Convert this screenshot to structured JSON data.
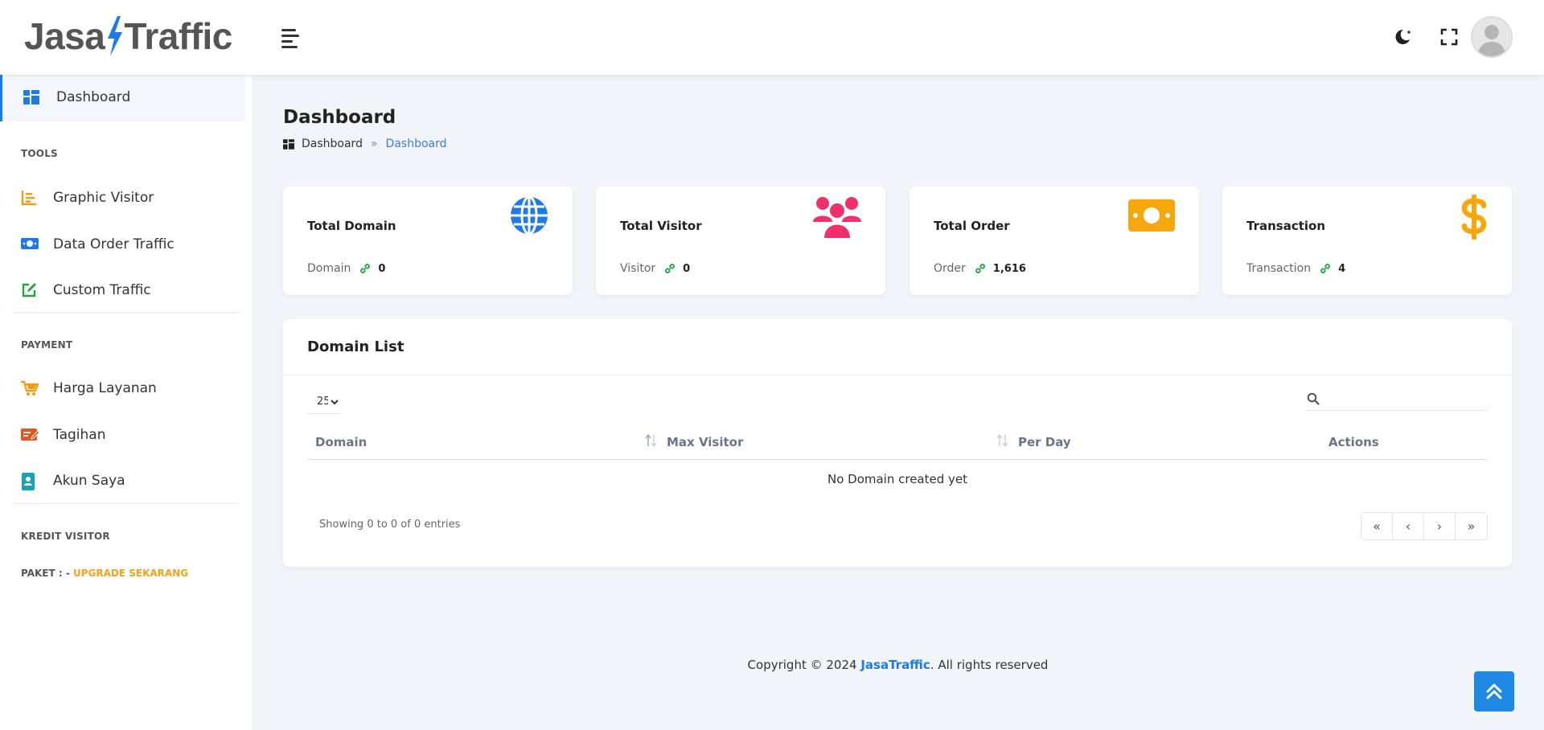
{
  "header": {
    "logo_left": "Jasa",
    "logo_right": "Traffic"
  },
  "sidebar": {
    "active": {
      "label": "Dashboard",
      "icon": "dashboard-grid-icon"
    },
    "sections": [
      {
        "title": "TOOLS",
        "items": [
          {
            "label": "Graphic Visitor",
            "icon": "bar-chart-icon",
            "color": "#f39c12"
          },
          {
            "label": "Data Order Traffic",
            "icon": "money-bill-icon",
            "color": "#1e7be6"
          },
          {
            "label": "Custom Traffic",
            "icon": "edit-icon",
            "color": "#21a544"
          }
        ]
      },
      {
        "title": "PAYMENT",
        "items": [
          {
            "label": "Harga Layanan",
            "icon": "cart-icon",
            "color": "#f39c12"
          },
          {
            "label": "Tagihan",
            "icon": "invoice-icon",
            "color": "#e8541e"
          },
          {
            "label": "Akun Saya",
            "icon": "id-card-icon",
            "color": "#17a2b8"
          }
        ]
      },
      {
        "title": "KREDIT VISITOR",
        "items": []
      }
    ],
    "paket_label": "PAKET : -",
    "paket_upgrade": "UPGRADE SEKARANG"
  },
  "main": {
    "title": "Dashboard",
    "breadcrumb": {
      "home": "Dashboard",
      "separator": "»",
      "current": "Dashboard"
    }
  },
  "cards": [
    {
      "title": "Total Domain",
      "sub_label": "Domain",
      "value": "0",
      "icon": "globe-icon",
      "color": "#1e7be6"
    },
    {
      "title": "Total Visitor",
      "sub_label": "Visitor",
      "value": "0",
      "icon": "users-icon",
      "color": "#f0306b"
    },
    {
      "title": "Total Order",
      "sub_label": "Order",
      "value": "1,616",
      "icon": "money-bill-icon",
      "color": "#f7a70c"
    },
    {
      "title": "Transaction",
      "sub_label": "Transaction",
      "value": "4",
      "icon": "dollar-icon",
      "color": "#f7a70c"
    }
  ],
  "domain_list": {
    "title": "Domain List",
    "page_length": "25",
    "search_placeholder": "",
    "columns": [
      "Domain",
      "Max Visitor",
      "Per Day",
      "Actions"
    ],
    "empty_text": "No Domain created yet",
    "info": "Showing 0 to 0 of 0 entries",
    "pager": [
      "«",
      "‹",
      "›",
      "»"
    ]
  },
  "footer": {
    "prefix": "Copyright © 2024 ",
    "brand": "JasaTraffic",
    "suffix": ". All rights reserved"
  },
  "colors": {
    "accent": "#1e7be6",
    "upgrade": "#f6a21a",
    "link_green": "#21a544"
  }
}
